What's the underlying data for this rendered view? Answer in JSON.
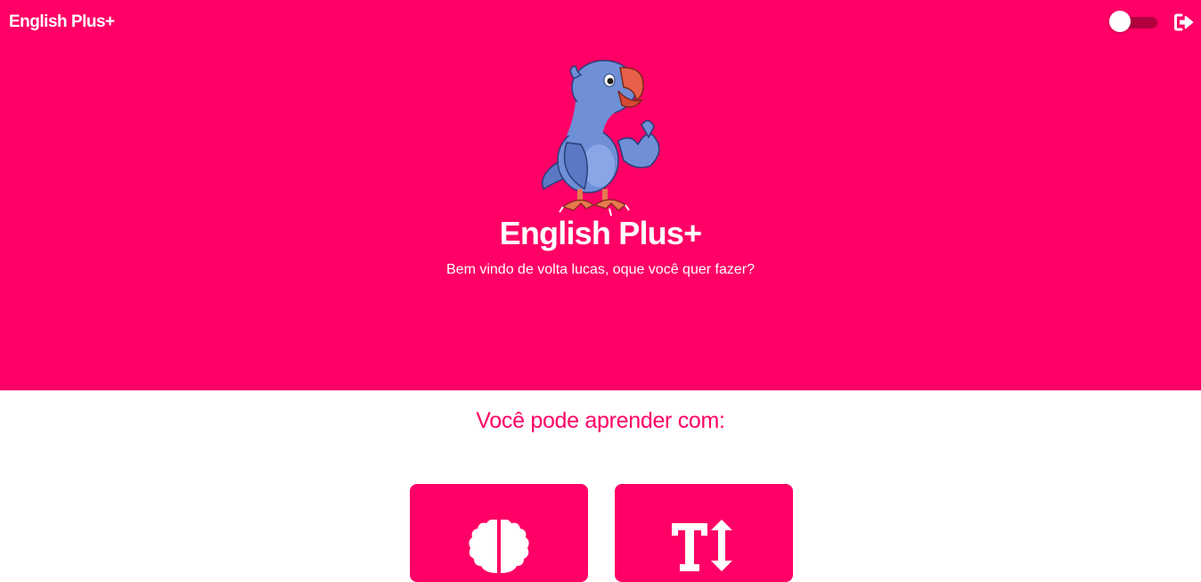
{
  "header": {
    "brand": "English Plus+",
    "theme_toggle_icon": "toggle-off-icon",
    "logout_icon": "sign-out-icon"
  },
  "hero": {
    "mascot_icon": "parrot-mascot",
    "title": "English Plus+",
    "subtitle": "Bem vindo de volta lucas, oque você quer fazer?"
  },
  "learn": {
    "title": "Você pode aprender com:",
    "cards": [
      {
        "icon": "brain-icon"
      },
      {
        "icon": "text-height-icon"
      }
    ]
  },
  "colors": {
    "primary": "#ff0066",
    "on_primary": "#ffffff",
    "toggle_track": "#b3003f",
    "parrot_body": "#6f8fd6",
    "parrot_beak": "#e8604a"
  }
}
